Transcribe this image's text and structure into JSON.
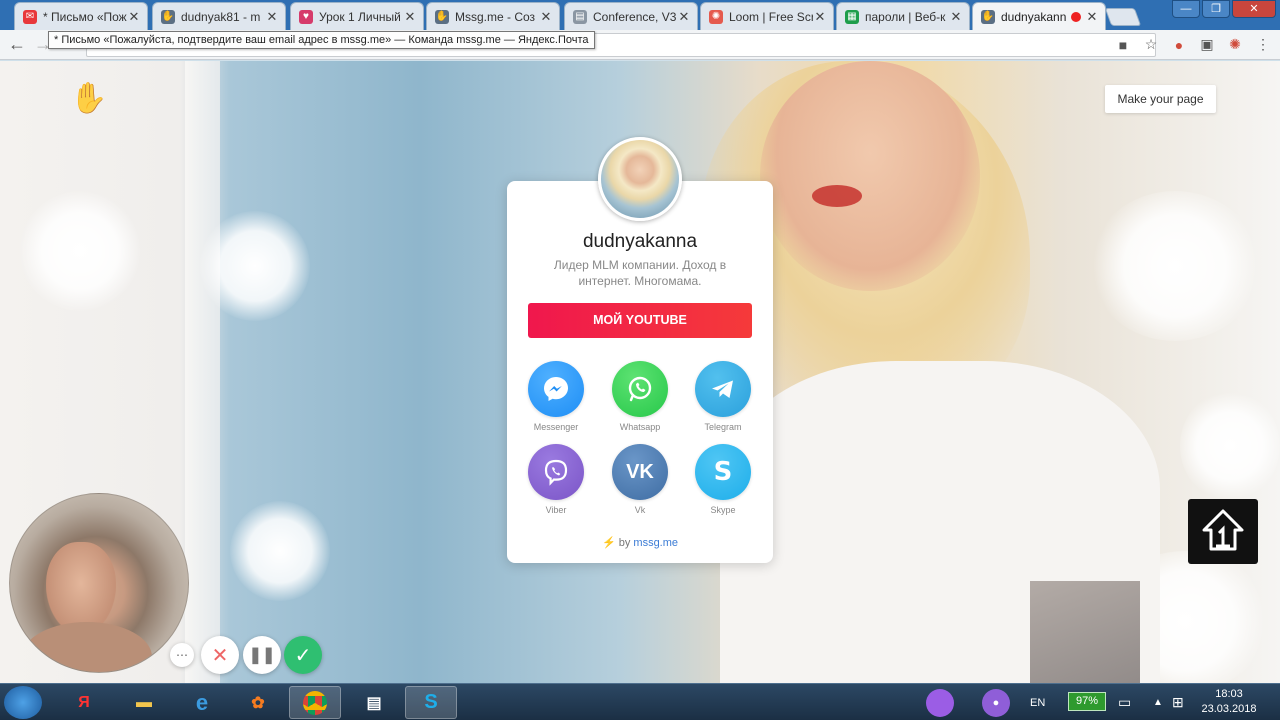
{
  "browser": {
    "tabs": [
      {
        "title": "* Письмо «Пож",
        "favicon": "mail-icon",
        "color": "#e8373a",
        "active": false
      },
      {
        "title": "dudnyak81 - m",
        "favicon": "hand-icon",
        "color": "#5b6f84",
        "active": false
      },
      {
        "title": "Урок 1 Личный",
        "favicon": "heart-icon",
        "color": "#d63b6b",
        "active": false
      },
      {
        "title": "Mssg.me - Соз",
        "favicon": "hand-icon",
        "color": "#5b6f84",
        "active": false
      },
      {
        "title": "Conference, V3",
        "favicon": "document-icon",
        "color": "#8a96a3",
        "active": false
      },
      {
        "title": "Loom | Free Scr",
        "favicon": "loom-icon",
        "color": "#e55a4e",
        "active": false
      },
      {
        "title": "пароли | Веб-к",
        "favicon": "sheets-icon",
        "color": "#1e9e4b",
        "active": false
      },
      {
        "title": "dudnyakann",
        "favicon": "hand-icon",
        "color": "#5b6f84",
        "active": true
      }
    ],
    "tooltip": "* Письмо «Пожалуйста, подтвердите ваш email адрес в mssg.me» — Команда mssg.me — Яндекс.Почта",
    "window_buttons": {
      "minimize": "—",
      "maximize": "❐",
      "close": "✕"
    }
  },
  "page": {
    "make_page_label": "Make your page",
    "profile": {
      "name": "dudnyakanna",
      "bio": "Лидер MLM компании. Доход в интернет. Многомама.",
      "youtube_button": "МОЙ YOUTUBE"
    },
    "messengers": [
      {
        "label": "Messenger",
        "icon": "messenger-icon",
        "color": "#1e8ef5"
      },
      {
        "label": "Whatsapp",
        "icon": "whatsapp-icon",
        "color": "#27c84a"
      },
      {
        "label": "Telegram",
        "icon": "telegram-icon",
        "color": "#2ba0dc"
      },
      {
        "label": "Viber",
        "icon": "viber-icon",
        "color": "#7b55c7"
      },
      {
        "label": "Vk",
        "icon": "vk-icon",
        "color": "#4a76a8"
      },
      {
        "label": "Skype",
        "icon": "skype-icon",
        "color": "#1eaeea"
      }
    ],
    "powered_prefix": "⚡ by",
    "powered_link": "mssg.me"
  },
  "taskbar": {
    "language": "EN",
    "battery": "97%",
    "time": "18:03",
    "date": "23.03.2018"
  }
}
